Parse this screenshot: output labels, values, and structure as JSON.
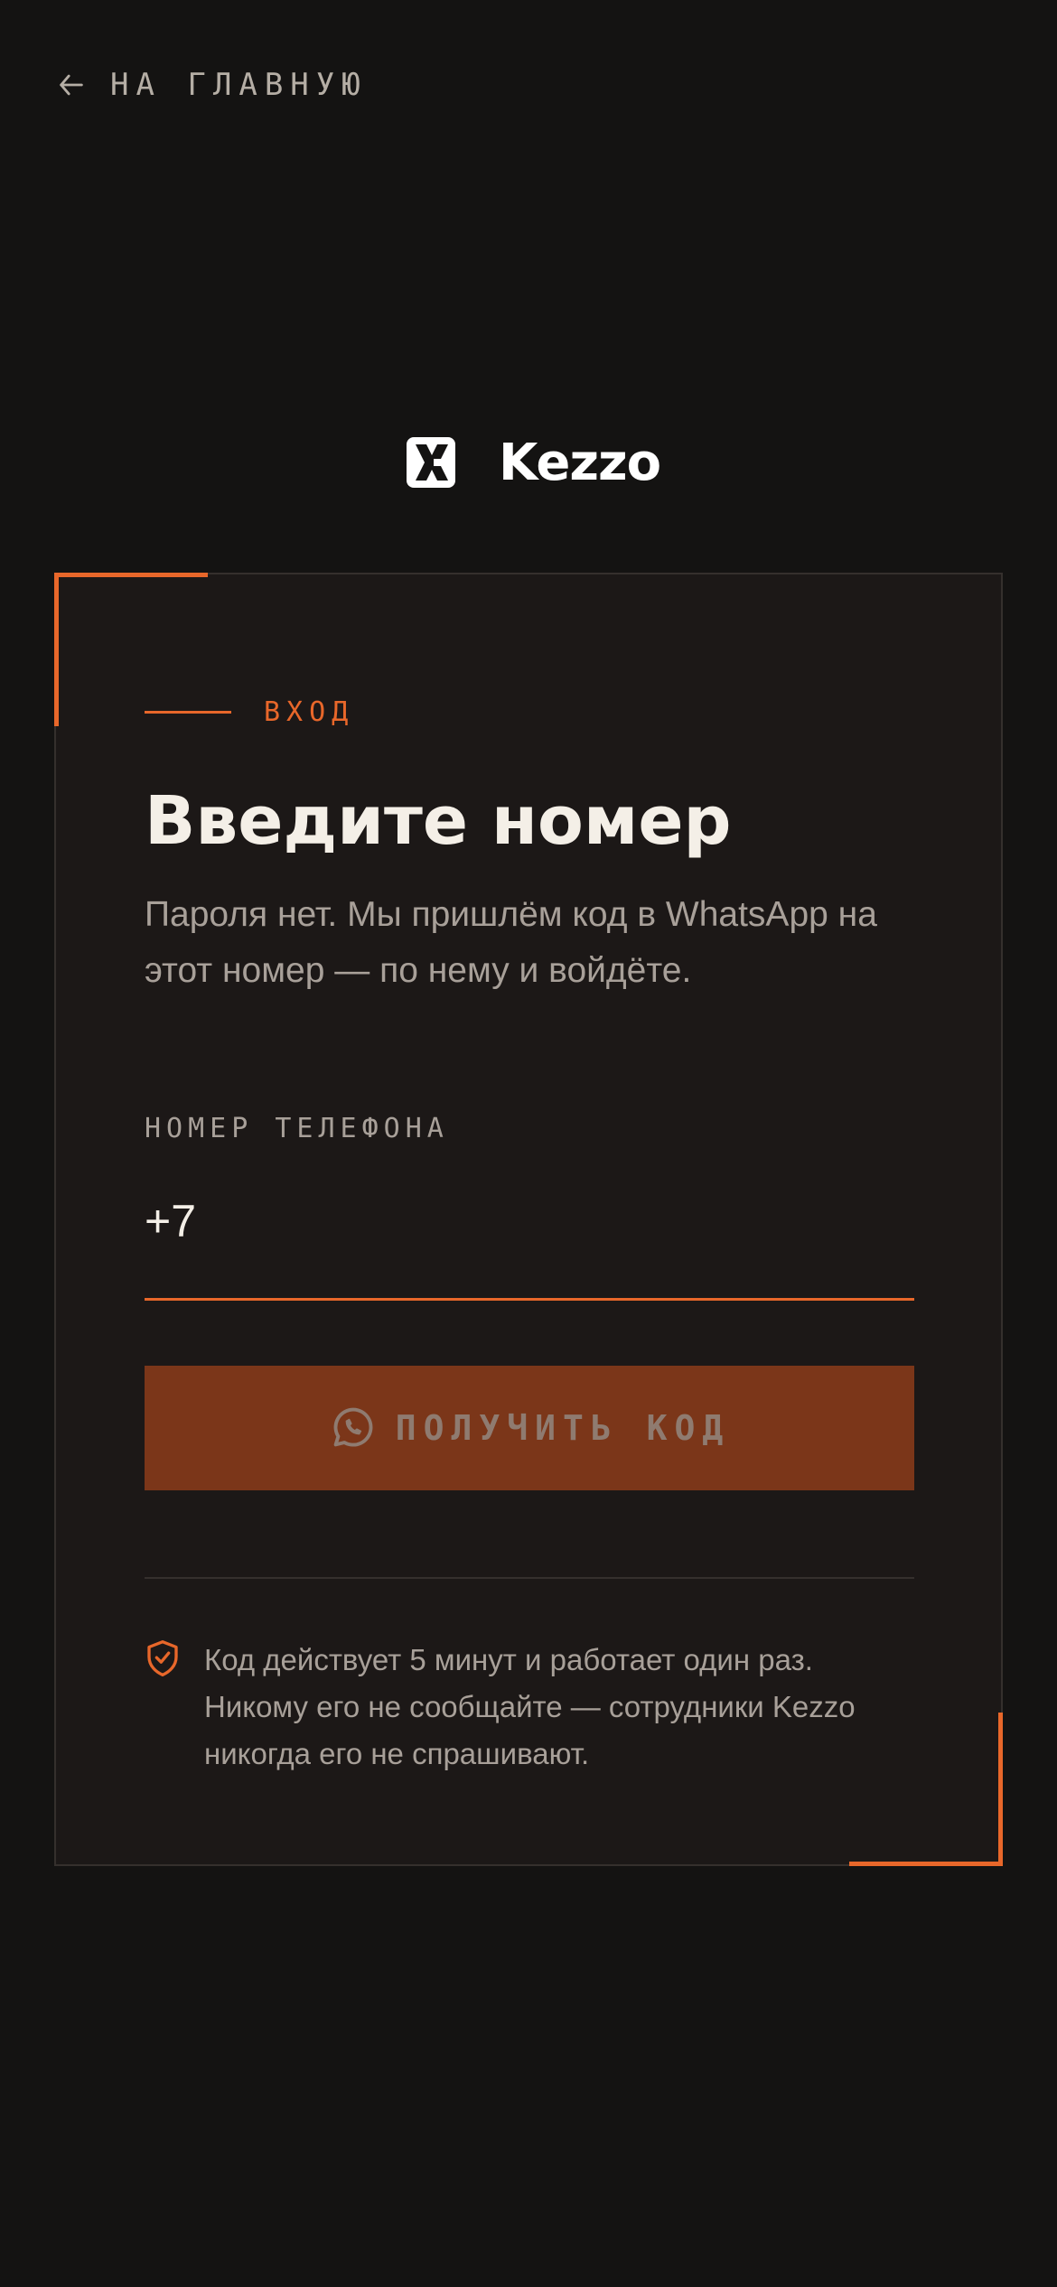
{
  "nav": {
    "back_label": "НА ГЛАВНУЮ"
  },
  "brand": {
    "name": "Kezzo"
  },
  "card": {
    "eyebrow": "ВХОД",
    "title": "Введите номер",
    "subtitle": "Пароля нет. Мы пришлём код в WhatsApp на этот номер — по нему и войдёте.",
    "phone_label": "НОМЕР ТЕЛЕФОНА",
    "phone_value": "+7",
    "submit_label": "ПОЛУЧИТЬ КОД",
    "note": "Код действует 5 минут и работает один раз. Никому его не сообщайте — сотрудники Kezzo никогда его не спрашивают."
  },
  "icons": {
    "back": "arrow-left-icon",
    "logo": "kezzo-logo-icon",
    "submit": "whatsapp-icon",
    "note": "shield-check-icon"
  },
  "colors": {
    "background": "#141312",
    "card": "#1c1817",
    "accent": "#e8672a",
    "button_disabled": "#7b3619",
    "text_primary": "#f4efe7",
    "text_muted": "#a8a099"
  }
}
